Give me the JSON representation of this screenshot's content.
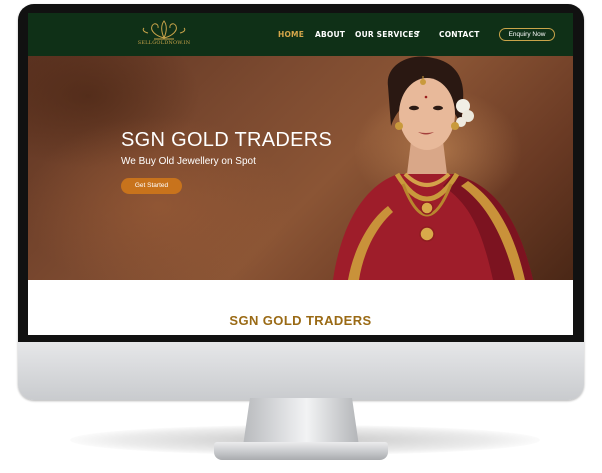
{
  "colors": {
    "nav_bg": "#0f3017",
    "accent_gold": "#d4a64a",
    "cta_orange": "#c8731c",
    "section_title": "#9a6a15"
  },
  "navbar": {
    "logo_text": "SELLGOLDNOW.IN",
    "items": [
      {
        "label": "HOME",
        "active": true
      },
      {
        "label": "ABOUT",
        "active": false
      },
      {
        "label": "OUR SERVICES",
        "active": false,
        "has_dropdown": true
      },
      {
        "label": "CONTACT",
        "active": false
      }
    ],
    "enquiry_label": "Enquiry Now"
  },
  "hero": {
    "title": "SGN GOLD TRADERS",
    "subtitle": "We Buy Old Jewellery on Spot",
    "cta_label": "Get Started"
  },
  "section": {
    "title": "SGN GOLD TRADERS"
  }
}
